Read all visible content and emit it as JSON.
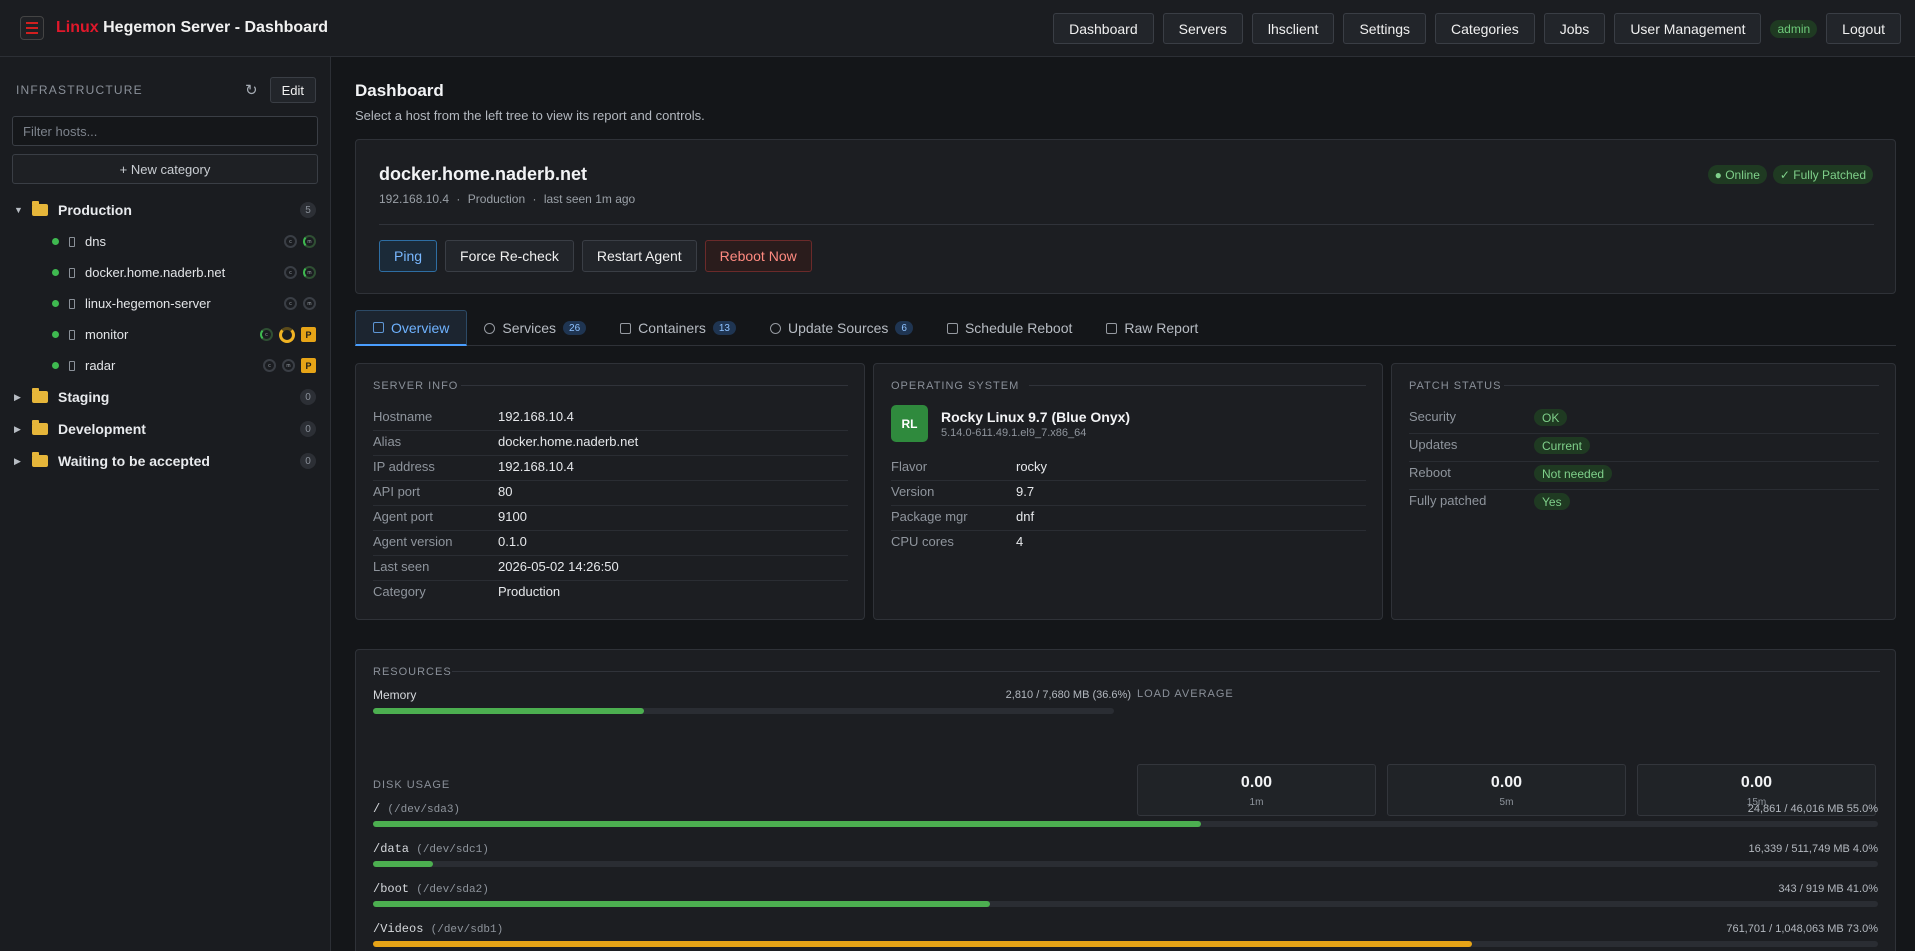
{
  "app": {
    "title_red": "Linux",
    "title_rest": " Hegemon Server - Dashboard"
  },
  "nav": {
    "items": [
      "Dashboard",
      "Servers",
      "lhsclient",
      "Settings",
      "Categories",
      "Jobs",
      "User Management"
    ],
    "user": "admin",
    "logout": "Logout"
  },
  "sidebar": {
    "title": "INFRASTRUCTURE",
    "refresh_icon": "↻",
    "edit_label": "Edit",
    "filter_placeholder": "Filter hosts...",
    "new_category": "+ New category",
    "categories": [
      {
        "name": "Production",
        "count": "5",
        "hosts": [
          {
            "name": "dns",
            "ring_c": "c",
            "ring_m": "m"
          },
          {
            "name": "docker.home.naderb.net",
            "ring_c": "c",
            "ring_m": "m"
          },
          {
            "name": "linux-hegemon-server",
            "ring_c": "c",
            "ring_m": "m"
          },
          {
            "name": "monitor",
            "ring_c": "c",
            "ring_m": "",
            "badge": "P"
          },
          {
            "name": "radar",
            "ring_c": "c",
            "ring_m": "m",
            "badge": "P"
          }
        ]
      },
      {
        "name": "Staging",
        "count": "0"
      },
      {
        "name": "Development",
        "count": "0"
      },
      {
        "name": "Waiting to be accepted",
        "count": "0"
      }
    ]
  },
  "page": {
    "title": "Dashboard",
    "subtitle": "Select a host from the left tree to view its report and controls."
  },
  "host": {
    "name": "docker.home.naderb.net",
    "ip": "192.168.10.4",
    "sep": "·",
    "category": "Production",
    "last_seen": "last seen 1m ago",
    "status_online": "● Online",
    "status_patched": "✓ Fully Patched",
    "actions": {
      "ping": "Ping",
      "recheck": "Force Re-check",
      "restart": "Restart Agent",
      "reboot": "Reboot Now"
    }
  },
  "tabs": [
    {
      "label": "Overview"
    },
    {
      "label": "Services",
      "count": "26"
    },
    {
      "label": "Containers",
      "count": "13"
    },
    {
      "label": "Update Sources",
      "count": "6"
    },
    {
      "label": "Schedule Reboot"
    },
    {
      "label": "Raw Report"
    }
  ],
  "server_info": {
    "title": "SERVER INFO",
    "rows": [
      {
        "k": "Hostname",
        "v": "192.168.10.4"
      },
      {
        "k": "Alias",
        "v": "docker.home.naderb.net"
      },
      {
        "k": "IP address",
        "v": "192.168.10.4"
      },
      {
        "k": "API port",
        "v": "80"
      },
      {
        "k": "Agent port",
        "v": "9100"
      },
      {
        "k": "Agent version",
        "v": "0.1.0"
      },
      {
        "k": "Last seen",
        "v": "2026-05-02 14:26:50"
      },
      {
        "k": "Category",
        "v": "Production"
      }
    ]
  },
  "os": {
    "title": "OPERATING SYSTEM",
    "logo": "RL",
    "name": "Rocky Linux 9.7 (Blue Onyx)",
    "kernel": "5.14.0-611.49.1.el9_7.x86_64",
    "rows": [
      {
        "k": "Flavor",
        "v": "rocky"
      },
      {
        "k": "Version",
        "v": "9.7"
      },
      {
        "k": "Package mgr",
        "v": "dnf"
      },
      {
        "k": "CPU cores",
        "v": "4"
      }
    ]
  },
  "patch": {
    "title": "PATCH STATUS",
    "rows": [
      {
        "k": "Security",
        "v": "OK"
      },
      {
        "k": "Updates",
        "v": "Current"
      },
      {
        "k": "Reboot",
        "v": "Not needed"
      },
      {
        "k": "Fully patched",
        "v": "Yes"
      }
    ]
  },
  "resources": {
    "title": "RESOURCES",
    "memory": {
      "label": "Memory",
      "text": "2,810 / 7,680 MB  (36.6%)",
      "pct": 36.6
    },
    "load_title": "LOAD AVERAGE",
    "load": [
      {
        "v": "0.00",
        "u": "1m"
      },
      {
        "v": "0.00",
        "u": "5m"
      },
      {
        "v": "0.00",
        "u": "15m"
      }
    ],
    "disk_title": "DISK USAGE",
    "disks": [
      {
        "mount": "/",
        "dev": "(/dev/sda3)",
        "text": "24,861 / 46,016 MB  55.0%",
        "pct": 55.0
      },
      {
        "mount": "/data",
        "dev": "(/dev/sdc1)",
        "text": "16,339 / 511,749 MB  4.0%",
        "pct": 4.0
      },
      {
        "mount": "/boot",
        "dev": "(/dev/sda2)",
        "text": "343 / 919 MB  41.0%",
        "pct": 41.0
      },
      {
        "mount": "/Videos",
        "dev": "(/dev/sdb1)",
        "text": "761,701 / 1,048,063 MB  73.0%",
        "pct": 73.0
      }
    ]
  },
  "colors": {
    "accent": "#4a9eff",
    "ok": "#3fb950",
    "warn": "#e6a417",
    "danger": "#ff8a80",
    "brand": "#e0182b"
  }
}
